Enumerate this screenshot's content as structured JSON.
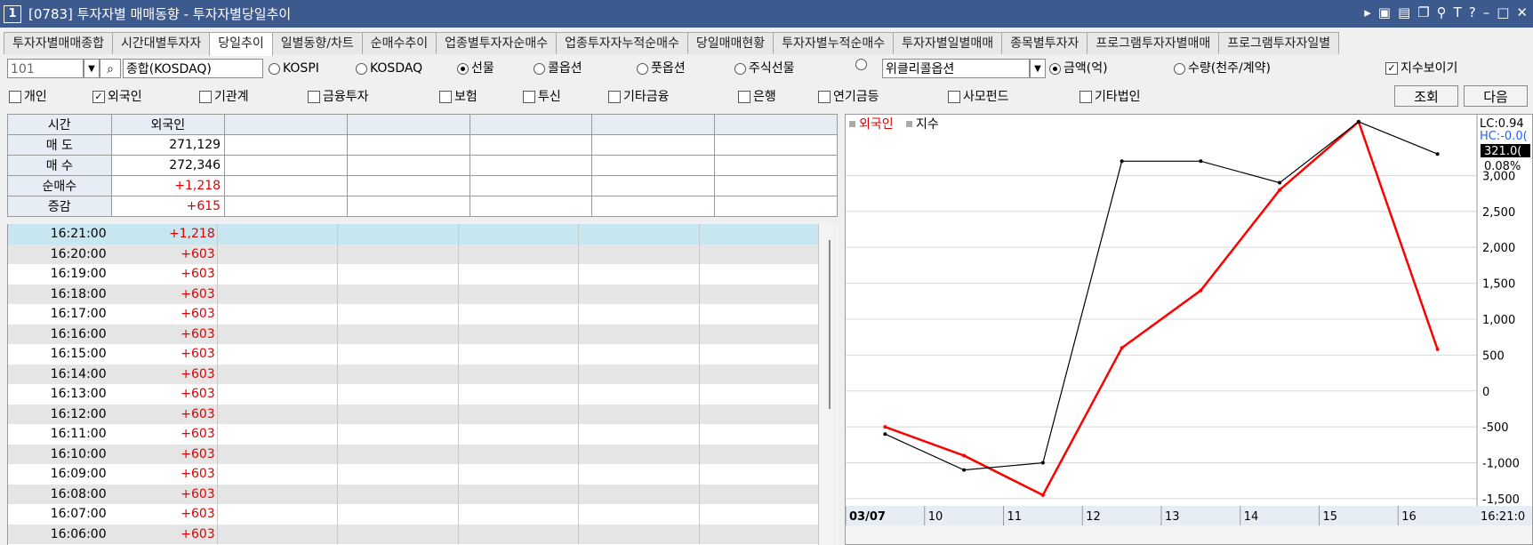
{
  "window": {
    "badge": "1",
    "title": "[0783] 투자자별 매매동향 - 투자자별당일추이"
  },
  "tabs": [
    "투자자별매매종합",
    "시간대별투자자",
    "당일추이",
    "일별동향/차트",
    "순매수추이",
    "업종별투자자순매수",
    "업종투자자누적순매수",
    "당일매매현황",
    "투자자별누적순매수",
    "투자자별일별매매",
    "종목별투자자",
    "프로그램투자자별매매",
    "프로그램투자자일별"
  ],
  "active_tab": "당일추이",
  "filters": {
    "code": "101",
    "market_name": "종합(KOSDAQ)",
    "markets": [
      "KOSPI",
      "KOSDAQ",
      "선물",
      "콜옵션",
      "풋옵션",
      "주식선물",
      ""
    ],
    "selected_market": "선물",
    "weekly": "위클리콜옵션",
    "units": [
      "금액(억)",
      "수량(천주/계약)"
    ],
    "selected_unit": "금액(억)",
    "show_index": "지수보이기"
  },
  "investors": [
    {
      "label": "개인",
      "checked": false
    },
    {
      "label": "외국인",
      "checked": true
    },
    {
      "label": "기관계",
      "checked": false
    },
    {
      "label": "금융투자",
      "checked": false
    },
    {
      "label": "보험",
      "checked": false
    },
    {
      "label": "투신",
      "checked": false
    },
    {
      "label": "기타금융",
      "checked": false
    },
    {
      "label": "은행",
      "checked": false
    },
    {
      "label": "연기금등",
      "checked": false
    },
    {
      "label": "사모펀드",
      "checked": false
    },
    {
      "label": "기타법인",
      "checked": false
    }
  ],
  "buttons": {
    "query": "조회",
    "next": "다음"
  },
  "summary": {
    "header_time": "시간",
    "header_col": "외국인",
    "rows": [
      {
        "label": "매 도",
        "value": "271,129",
        "red": false
      },
      {
        "label": "매 수",
        "value": "272,346",
        "red": false
      },
      {
        "label": "순매수",
        "value": "+1,218",
        "red": true
      },
      {
        "label": "증감",
        "value": "+615",
        "red": true
      }
    ]
  },
  "timeline": [
    {
      "time": "16:21:00",
      "value": "+1,218"
    },
    {
      "time": "16:20:00",
      "value": "+603"
    },
    {
      "time": "16:19:00",
      "value": "+603"
    },
    {
      "time": "16:18:00",
      "value": "+603"
    },
    {
      "time": "16:17:00",
      "value": "+603"
    },
    {
      "time": "16:16:00",
      "value": "+603"
    },
    {
      "time": "16:15:00",
      "value": "+603"
    },
    {
      "time": "16:14:00",
      "value": "+603"
    },
    {
      "time": "16:13:00",
      "value": "+603"
    },
    {
      "time": "16:12:00",
      "value": "+603"
    },
    {
      "time": "16:11:00",
      "value": "+603"
    },
    {
      "time": "16:10:00",
      "value": "+603"
    },
    {
      "time": "16:09:00",
      "value": "+603"
    },
    {
      "time": "16:08:00",
      "value": "+603"
    },
    {
      "time": "16:07:00",
      "value": "+603"
    },
    {
      "time": "16:06:00",
      "value": "+603"
    }
  ],
  "chart": {
    "legend": [
      "외국인",
      "지수"
    ],
    "lc": "LC:0.94",
    "hc": "HC:-0.0(",
    "tag": "321.0(",
    "tag_pct": "0.08%",
    "x_labels": [
      "03/07",
      "10",
      "11",
      "12",
      "13",
      "14",
      "15",
      "16"
    ],
    "y_labels": [
      "3,000",
      "2,500",
      "2,000",
      "1,500",
      "1,000",
      "500",
      "0",
      "-500",
      "-1,000",
      "-1,500"
    ],
    "time_label": "16:21:0",
    "colors": {
      "foreign": "#ff0000",
      "index": "#000000"
    }
  },
  "chart_data": {
    "type": "line",
    "x": [
      "03/07",
      "10",
      "11",
      "12",
      "13",
      "14",
      "15",
      "16"
    ],
    "series": [
      {
        "name": "외국인",
        "values": [
          -500,
          -900,
          -1450,
          600,
          1400,
          2800,
          3750,
          580
        ]
      },
      {
        "name": "지수",
        "values": [
          -600,
          -1100,
          -1000,
          3200,
          3200,
          2900,
          3750,
          3300
        ]
      }
    ],
    "ylim": [
      -1600,
      3600
    ],
    "grid": true,
    "legend_position": "top-left"
  }
}
